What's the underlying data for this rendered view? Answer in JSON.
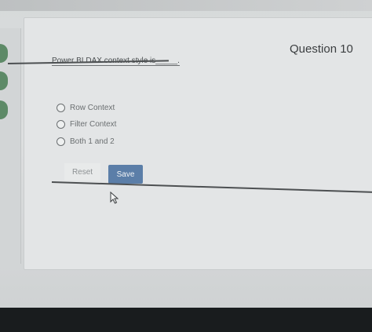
{
  "question": {
    "title": "Question 10",
    "text": "Power BI DAX context style is_____."
  },
  "options": [
    {
      "label": "Row Context"
    },
    {
      "label": "Filter Context"
    },
    {
      "label": "Both 1 and 2"
    }
  ],
  "actions": {
    "reset_label": "Reset",
    "save_label": "Save"
  },
  "colors": {
    "save_button": "#5b7ea8",
    "nav_indicator": "#5d8a67"
  }
}
